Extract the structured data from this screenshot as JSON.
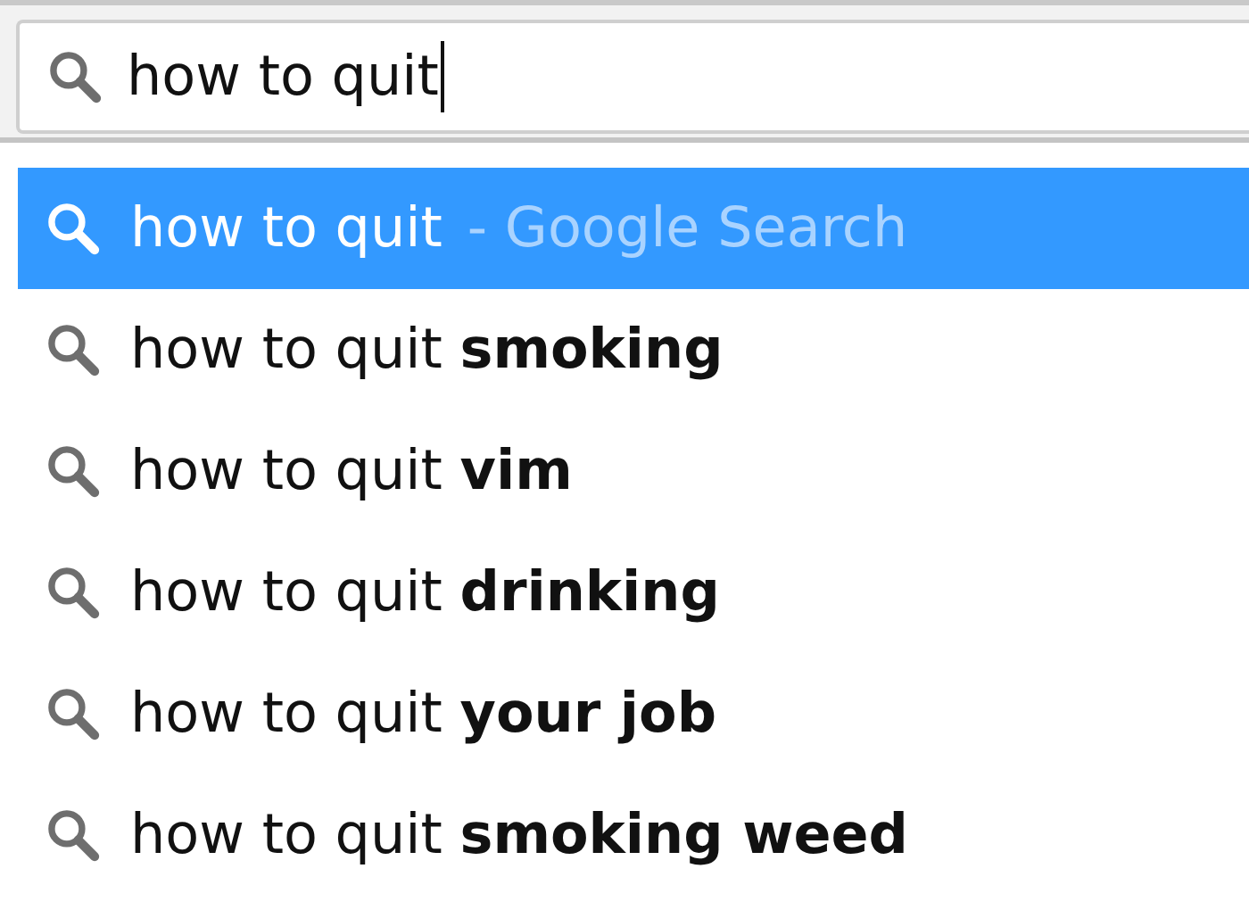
{
  "search_field": {
    "value": "how to quit"
  },
  "suggestions": [
    {
      "kind": "search",
      "text": "how to quit",
      "hint": "- Google Search",
      "selected": true
    },
    {
      "kind": "completion",
      "text": "how to quit **smoking**",
      "selected": false
    },
    {
      "kind": "completion",
      "text": "how to quit **vim**",
      "selected": false
    },
    {
      "kind": "completion",
      "text": "how to quit **drinking**",
      "selected": false
    },
    {
      "kind": "completion",
      "text": "how to quit **your job**",
      "selected": false
    },
    {
      "kind": "completion",
      "text": "how to quit **smoking weed**",
      "selected": false
    }
  ]
}
